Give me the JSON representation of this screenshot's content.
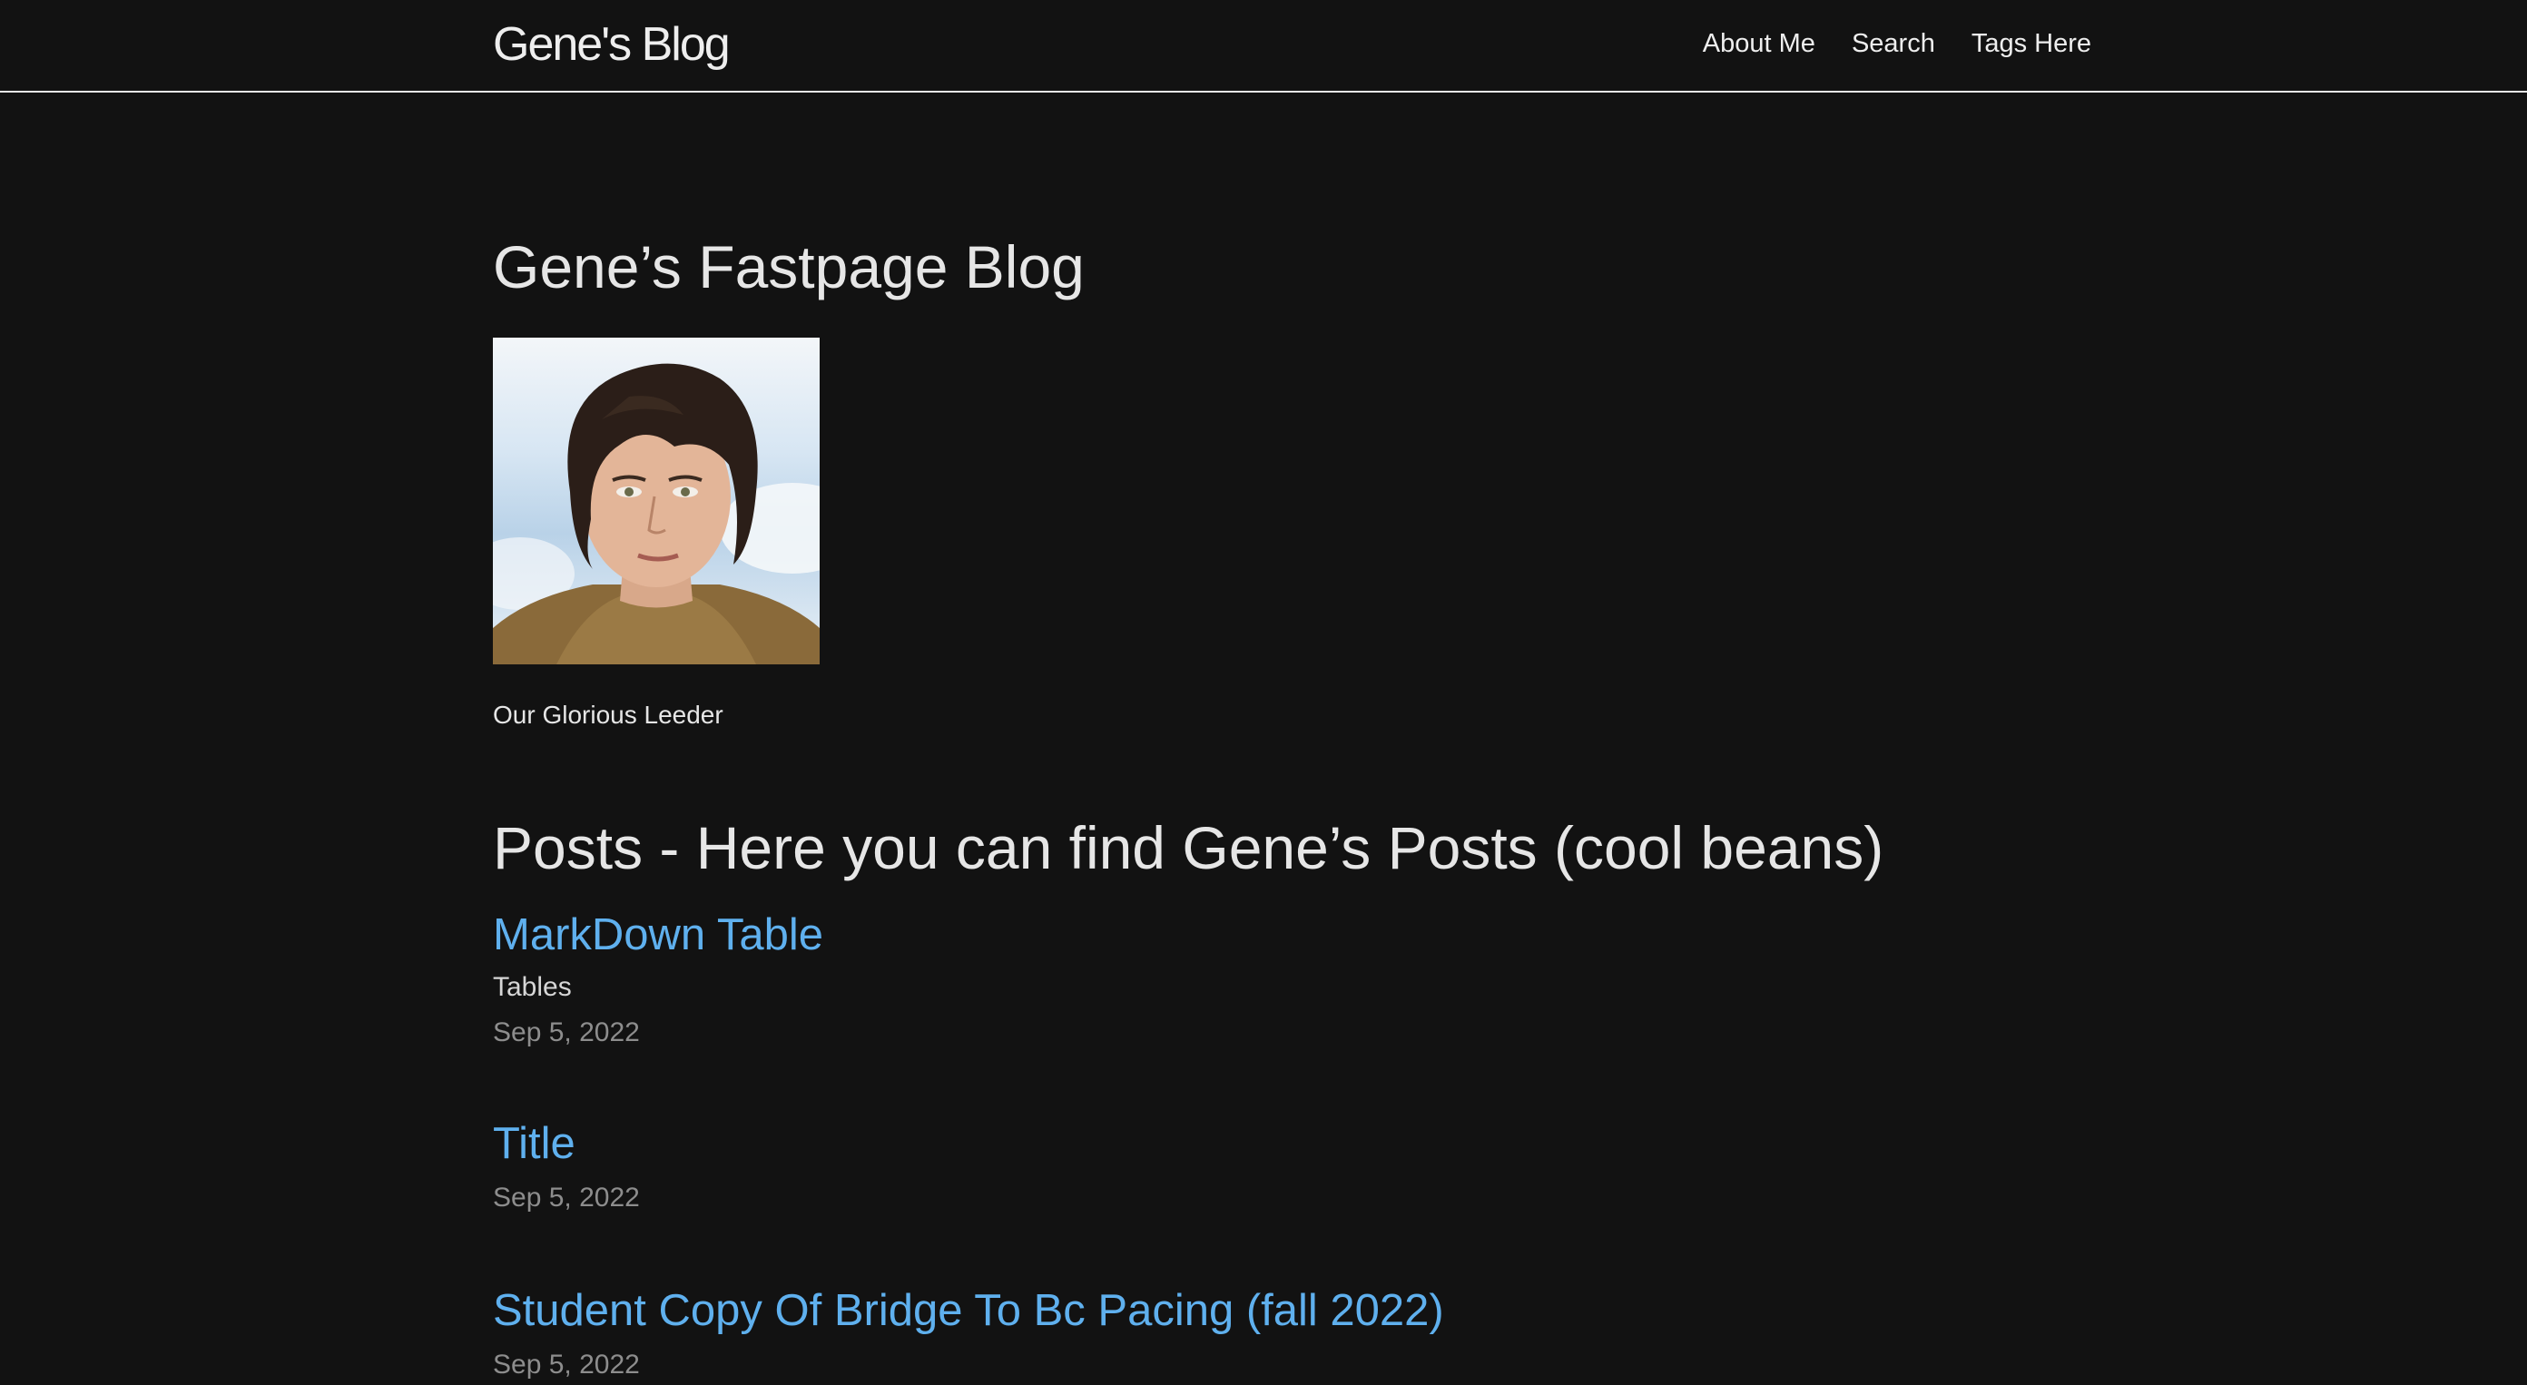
{
  "header": {
    "site_title": "Gene's Blog",
    "nav": [
      {
        "label": "About Me"
      },
      {
        "label": "Search"
      },
      {
        "label": "Tags Here"
      }
    ]
  },
  "main": {
    "heading": "Gene’s Fastpage Blog",
    "image_caption": "Our Glorious Leeder",
    "posts_heading": "Posts - Here you can find Gene’s Posts (cool beans)",
    "posts": [
      {
        "title": "MarkDown Table",
        "description": "Tables",
        "date": "Sep 5, 2022"
      },
      {
        "title": "Title",
        "date": "Sep 5, 2022"
      },
      {
        "title": "Student Copy Of Bridge To Bc Pacing (fall 2022)",
        "date": "Sep 5, 2022"
      }
    ]
  },
  "colors": {
    "background": "#121212",
    "link": "#5fb0ee",
    "text": "#e6e6e6",
    "meta": "#8d8d8d"
  }
}
